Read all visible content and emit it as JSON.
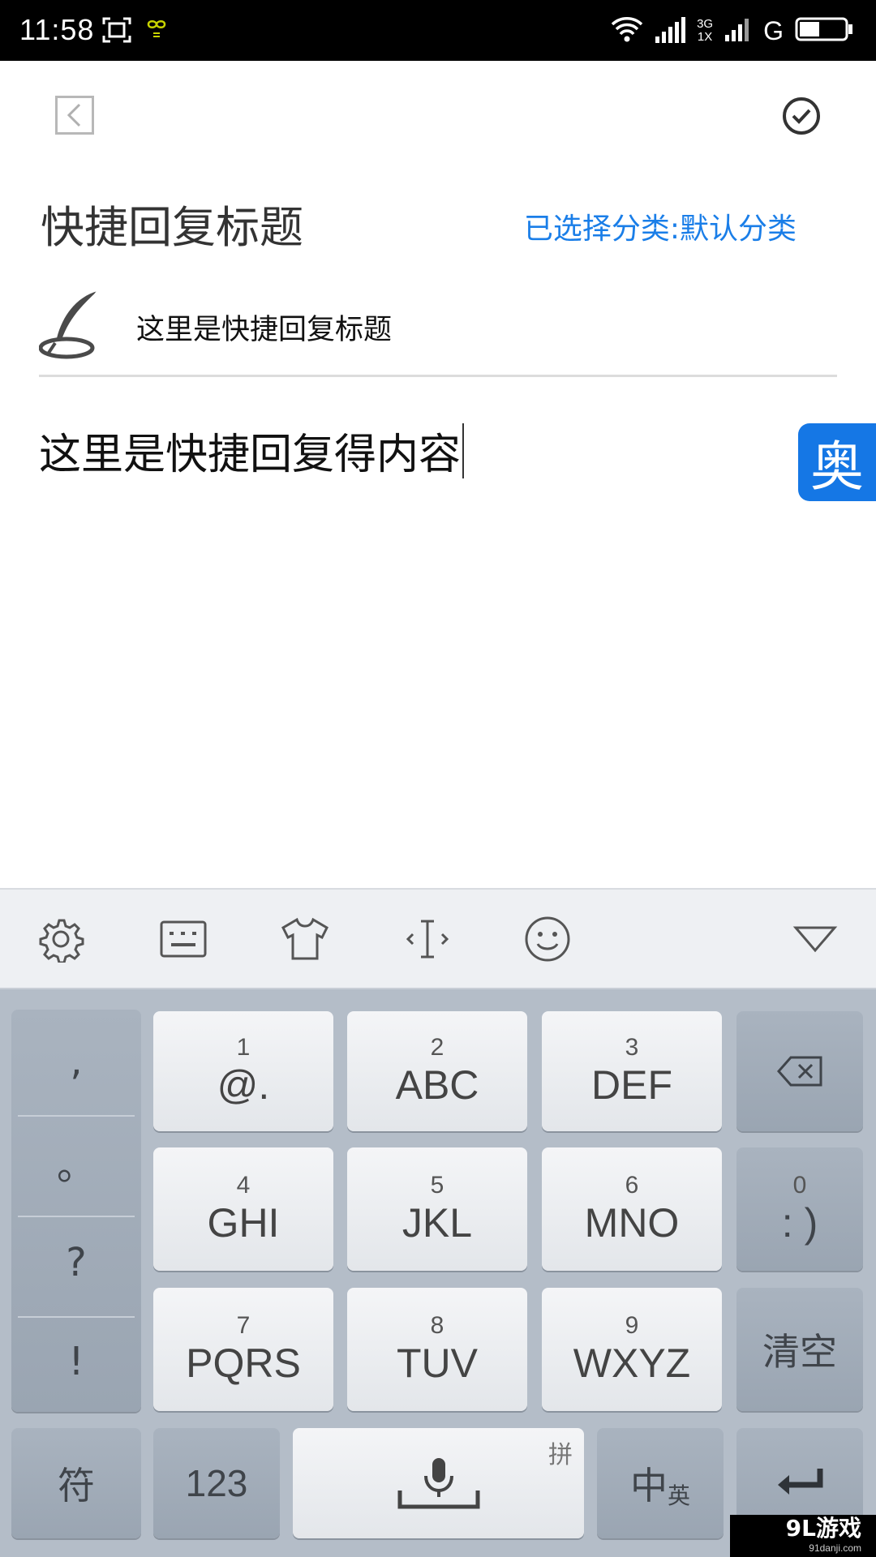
{
  "status_bar": {
    "time": "11:58",
    "network_top": "3G",
    "network_bottom": "1X",
    "carrier_g": "G",
    "battery_level": 0.45
  },
  "header": {
    "title": "快捷回复标题",
    "category_label": "已选择分类:默认分类"
  },
  "form": {
    "title_value": "这里是快捷回复标题",
    "content_value": "这里是快捷回复得内容"
  },
  "floating_app": {
    "label": "奥"
  },
  "keyboard": {
    "toolbar_icons": [
      "gear-icon",
      "keyboard-icon",
      "shirt-icon",
      "cursor-move-icon",
      "emoji-icon",
      "collapse-triangle-icon"
    ],
    "punctuation": [
      ",",
      "。",
      "?",
      "!"
    ],
    "keys": [
      {
        "num": "1",
        "letters": "@."
      },
      {
        "num": "2",
        "letters": "ABC"
      },
      {
        "num": "3",
        "letters": "DEF"
      },
      {
        "num": "4",
        "letters": "GHI"
      },
      {
        "num": "5",
        "letters": "JKL"
      },
      {
        "num": "6",
        "letters": "MNO"
      },
      {
        "num": "7",
        "letters": "PQRS"
      },
      {
        "num": "8",
        "letters": "TUV"
      },
      {
        "num": "9",
        "letters": "WXYZ"
      }
    ],
    "smiley_key": {
      "num": "0",
      "label": ": )"
    },
    "clear_label": "清空",
    "symbols_label": "符",
    "numbers_label": "123",
    "pinyin_label": "拼",
    "lang_main": "中",
    "lang_sub": "英"
  },
  "watermark": {
    "main": "9L游戏",
    "sub": "91danji.com"
  },
  "colors": {
    "accent": "#1a7ee8",
    "app_icon": "#1577e5",
    "keyboard_bg": "#b4bdc8"
  }
}
